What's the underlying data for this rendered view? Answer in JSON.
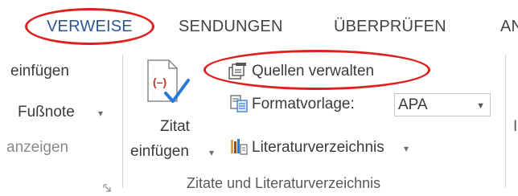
{
  "tabs": [
    {
      "label": "VERWEISE",
      "active": true
    },
    {
      "label": "SENDUNGEN",
      "active": false
    },
    {
      "label": "ÜBERPRÜFEN",
      "active": false
    },
    {
      "label": "AN",
      "active": false
    }
  ],
  "left_group": {
    "insert_label": "einfügen",
    "footnote_label": "Fußnote",
    "show_label": "anzeigen"
  },
  "citations": {
    "insert_citation_line1": "Zitat",
    "insert_citation_line2": "einfügen",
    "manage_sources": "Quellen verwalten",
    "style_label": "Formatvorlage:",
    "style_value": "APA",
    "bibliography": "Literaturverzeichnis",
    "group_label": "Zitate und Literaturverzeichnis"
  },
  "icons": {
    "insert_citation": "citation-insert-icon",
    "manage_sources": "manage-sources-icon",
    "style": "style-format-icon",
    "bibliography": "bibliography-icon",
    "dialog_launcher": "dialog-launcher-icon"
  },
  "colors": {
    "active_tab": "#2b579a",
    "highlight_ring": "#e02020",
    "citation_red": "#c0392b",
    "check_blue": "#2b79d6"
  }
}
